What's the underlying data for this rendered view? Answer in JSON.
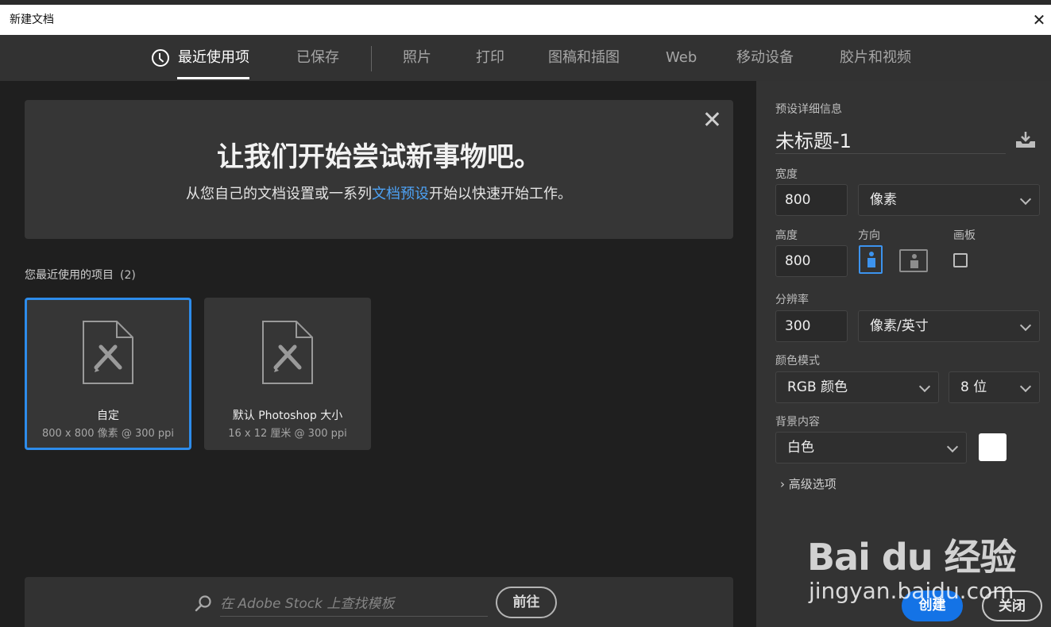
{
  "window": {
    "title": "新建文档",
    "close_glyph": "✕"
  },
  "tabs": [
    {
      "label": "最近使用项",
      "active": true
    },
    {
      "label": "已保存"
    },
    {
      "label": "照片"
    },
    {
      "label": "打印"
    },
    {
      "label": "图稿和插图"
    },
    {
      "label": "Web"
    },
    {
      "label": "移动设备"
    },
    {
      "label": "胶片和视频"
    }
  ],
  "hero": {
    "headline": "让我们开始尝试新事物吧。",
    "sub_before": "从您自己的文档设置或一系列",
    "sub_link": "文档预设",
    "sub_after": "开始以快速开始工作。",
    "dismiss_glyph": "✕"
  },
  "recent": {
    "title": "您最近使用的项目",
    "count": "(2)",
    "items": [
      {
        "name": "自定",
        "meta": "800 x 800 像素 @ 300 ppi",
        "selected": true
      },
      {
        "name": "默认 Photoshop 大小",
        "meta": "16 x 12 厘米 @ 300 ppi"
      }
    ]
  },
  "stock": {
    "placeholder": "在 Adobe Stock 上查找模板",
    "go_label": "前往"
  },
  "preset": {
    "section_title": "预设详细信息",
    "doc_name": "未标题-1",
    "width_label": "宽度",
    "width_value": "800",
    "width_unit": "像素",
    "height_label": "高度",
    "height_value": "800",
    "orientation_label": "方向",
    "orientation_selected": "portrait",
    "artboard_label": "画板",
    "artboard_checked": false,
    "resolution_label": "分辨率",
    "resolution_value": "300",
    "resolution_unit": "像素/英寸",
    "color_mode_label": "颜色模式",
    "color_mode": "RGB 颜色",
    "bit_depth": "8 位",
    "background_label": "背景内容",
    "background": "白色",
    "background_color": "#ffffff",
    "advanced_label": "高级选项",
    "chevron_glyph": "›"
  },
  "actions": {
    "create_label": "创建",
    "close_label": "关闭"
  },
  "watermark": {
    "text": "Bai du 经验",
    "url": "jingyan.baidu.com"
  },
  "colors": {
    "accent": "#1473e6",
    "selection": "#2d8ceb",
    "link": "#4da2f5"
  }
}
